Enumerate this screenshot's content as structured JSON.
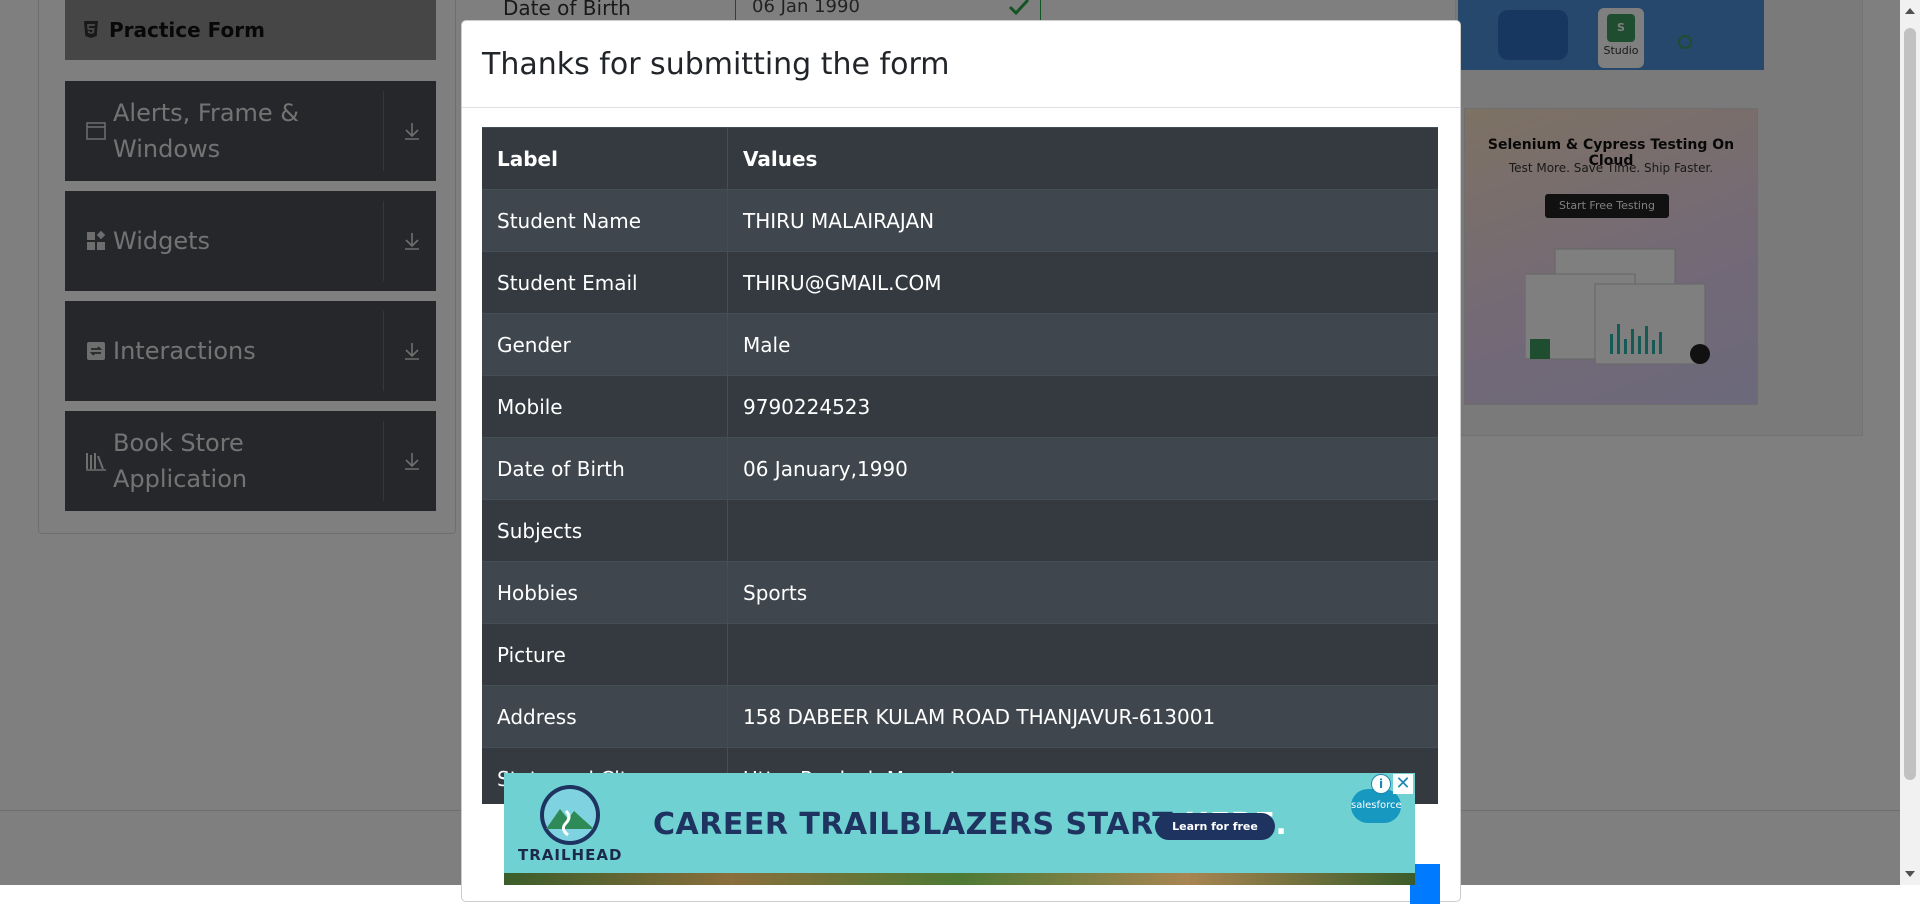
{
  "sidebar": {
    "practice_form": "Practice Form",
    "items": [
      {
        "label": "Alerts, Frame & Windows",
        "icon": "window-icon"
      },
      {
        "label": "Widgets",
        "icon": "widgets-icon"
      },
      {
        "label": "Interactions",
        "icon": "interactions-icon"
      },
      {
        "label": "Book Store Application",
        "icon": "books-icon"
      }
    ]
  },
  "form_background": {
    "dob_label": "Date of Birth",
    "dob_value": "06 Jan 1990"
  },
  "right_ads": {
    "studio_label": "Studio",
    "cloud_title": "Selenium & Cypress Testing On Cloud",
    "cloud_subtitle": "Test More. Save Time. Ship Faster.",
    "cloud_button": "Start Free Testing"
  },
  "modal": {
    "title": "Thanks for submitting the form",
    "table": {
      "headers": [
        "Label",
        "Values"
      ],
      "rows": [
        [
          "Student Name",
          "THIRU MALAIRAJAN"
        ],
        [
          "Student Email",
          "THIRU@GMAIL.COM"
        ],
        [
          "Gender",
          "Male"
        ],
        [
          "Mobile",
          "9790224523"
        ],
        [
          "Date of Birth",
          "06 January,1990"
        ],
        [
          "Subjects",
          ""
        ],
        [
          "Hobbies",
          "Sports"
        ],
        [
          "Picture",
          ""
        ],
        [
          "Address",
          "158 DABEER KULAM ROAD THANJAVUR-613001"
        ],
        [
          "State and City",
          "Uttar Pradesh Meerut"
        ]
      ]
    }
  },
  "bottom_ad": {
    "brand": "TRAILHEAD",
    "headline_main": "CAREER TRAILBLAZERS START ",
    "headline_highlight": "HERE.",
    "cta": "Learn for free",
    "partner": "salesforce",
    "adchoice": "i",
    "close": "✕"
  },
  "colors": {
    "table_dark": "#343a40",
    "table_stripe": "#3f464d",
    "sidebar_bg": "#4a4f54",
    "ad_bg": "#6fd1d1",
    "accent_blue": "#007bff"
  }
}
